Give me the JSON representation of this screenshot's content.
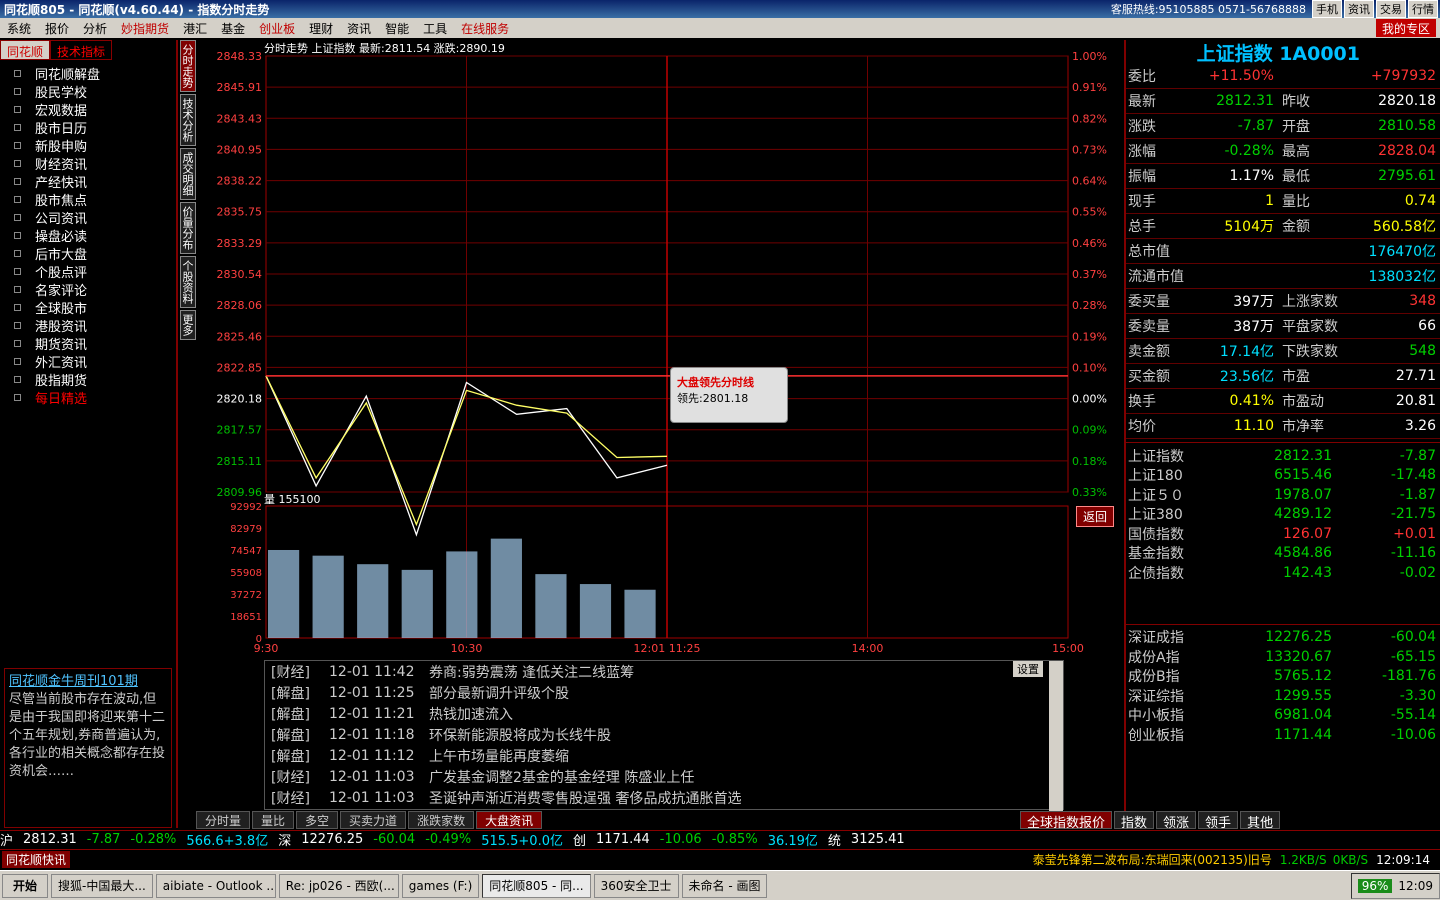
{
  "window": {
    "title": "同花顺805 - 同花顺(v4.60.44) - 指数分时走势",
    "hotline": "客服热线:95105885 0571-56768888",
    "buttons": [
      "手机",
      "资讯",
      "交易",
      "行情"
    ]
  },
  "menu": {
    "items": [
      "系统",
      "报价",
      "分析",
      "妙指期货",
      "港汇",
      "基金",
      "创业板",
      "理财",
      "资讯",
      "智能",
      "工具",
      "在线服务"
    ],
    "red_items": [
      3,
      6,
      11
    ],
    "zone": "我的专区"
  },
  "left_panel": {
    "tabs": [
      "同花顺",
      "技术指标"
    ],
    "items": [
      "同花顺解盘",
      "股民学校",
      "宏观数据",
      "股市日历",
      "新股申购",
      "财经资讯",
      "产经快讯",
      "股市焦点",
      "公司资讯",
      "操盘必读",
      "后市大盘",
      "个股点评",
      "名家评论",
      "全球股市",
      "港股资讯",
      "期货资讯",
      "外汇资讯",
      "股指期货",
      "每日精选"
    ],
    "news_box": {
      "headline": "同花顺金牛周刊101期",
      "body": "尽管当前股市存在波动,但是由于我国即将迎来第十二个五年规划,券商普遍认为,各行业的相关概念都存在投资机会……"
    }
  },
  "vertical_tabs": [
    "分时走势",
    "技术分析",
    "成交明细",
    "价量分布",
    "个股资料",
    "更多"
  ],
  "chart": {
    "header": "分时走势  上证指数  最新:2811.54  涨跌:2890.19",
    "vol_header": "量 155100",
    "tip_title": "大盘领先分时线",
    "tip_value": "领先:2801.18",
    "back_label": "返回",
    "price_ticks": [
      "2848.33",
      "2845.91",
      "2843.43",
      "2840.95",
      "2838.22",
      "2835.75",
      "2833.29",
      "2830.54",
      "2828.06",
      "2825.46",
      "2822.85",
      "2820.18",
      "2817.57",
      "2815.11",
      "2809.96"
    ],
    "pct_ticks": [
      "1.00%",
      "0.91%",
      "0.82%",
      "0.73%",
      "0.64%",
      "0.55%",
      "0.46%",
      "0.37%",
      "0.28%",
      "0.19%",
      "0.10%",
      "0.00%",
      "0.09%",
      "0.18%",
      "0.33%"
    ],
    "vol_ticks": [
      "92992",
      "82979",
      "74547",
      "55908",
      "37272",
      "18651",
      "0"
    ],
    "time_ticks": [
      "9:30",
      "10:30",
      "12:01 11:25",
      "14:00",
      "15:00"
    ]
  },
  "chart_data": {
    "type": "line",
    "title": "",
    "xlabel": "",
    "ylabel": "",
    "ylim": [
      2809.96,
      2848.33
    ],
    "x": [
      "9:30",
      "9:45",
      "10:00",
      "10:15",
      "10:30",
      "10:45",
      "11:00",
      "11:15",
      "11:25"
    ],
    "series": [
      {
        "name": "",
        "values": [
          2820.18,
          2810.5,
          2818.4,
          2806.2,
          2819.6,
          2816.8,
          2817.3,
          2811.2,
          2812.31
        ]
      },
      {
        "name": "",
        "values": [
          2820.18,
          2811.2,
          2817.8,
          2807.1,
          2818.9,
          2817.6,
          2816.9,
          2813.0,
          2813.1
        ]
      }
    ],
    "volume": [
      62000,
      58000,
      52000,
      48000,
      61000,
      70000,
      45000,
      38000,
      34000
    ]
  },
  "news_list": {
    "settings": "设置",
    "rows": [
      {
        "cat": "[财经]",
        "date": "12-01 11:42",
        "text": "券商:弱势震荡 逢低关注二线蓝筹"
      },
      {
        "cat": "[解盘]",
        "date": "12-01 11:25",
        "text": "部分最新调升评级个股"
      },
      {
        "cat": "[解盘]",
        "date": "12-01 11:21",
        "text": "热钱加速流入"
      },
      {
        "cat": "[解盘]",
        "date": "12-01 11:18",
        "text": "环保新能源股将成为长线牛股"
      },
      {
        "cat": "[解盘]",
        "date": "12-01 11:12",
        "text": "上午市场量能再度萎缩"
      },
      {
        "cat": "[财经]",
        "date": "12-01 11:03",
        "text": "广发基金调整2基金的基金经理 陈盛业上任"
      },
      {
        "cat": "[财经]",
        "date": "12-01 11:03",
        "text": "圣诞钟声渐近消费零售股逞强  奢侈品成抗通胀首选"
      }
    ]
  },
  "bottom_tabs": [
    "分时量",
    "量比",
    "多空",
    "买卖力道",
    "涨跌家数",
    "大盘资讯"
  ],
  "right_panel": {
    "title": "上证指数 1A0001",
    "rows": [
      {
        "l1": "委比",
        "v1": "+11.50%",
        "c1": "up",
        "l2": "",
        "v2": "+797932",
        "c2": "up"
      },
      {
        "l1": "最新",
        "v1": "2812.31",
        "c1": "dn",
        "l2": "昨收",
        "v2": "2820.18",
        "c2": "wh"
      },
      {
        "l1": "涨跌",
        "v1": "-7.87",
        "c1": "dn",
        "l2": "开盘",
        "v2": "2810.58",
        "c2": "dn"
      },
      {
        "l1": "涨幅",
        "v1": "-0.28%",
        "c1": "dn",
        "l2": "最高",
        "v2": "2828.04",
        "c2": "up"
      },
      {
        "l1": "振幅",
        "v1": "1.17%",
        "c1": "wh",
        "l2": "最低",
        "v2": "2795.61",
        "c2": "dn"
      },
      {
        "l1": "现手",
        "v1": "1",
        "c1": "yl",
        "l2": "量比",
        "v2": "0.74",
        "c2": "yl"
      },
      {
        "l1": "总手",
        "v1": "5104万",
        "c1": "yl",
        "l2": "金额",
        "v2": "560.58亿",
        "c2": "yl"
      },
      {
        "l1": "总市值",
        "v1": "",
        "c1": "wh",
        "l2": "",
        "v2": "176470亿",
        "c2": "cy"
      },
      {
        "l1": "流通市值",
        "v1": "",
        "c1": "wh",
        "l2": "",
        "v2": "138032亿",
        "c2": "cy"
      },
      {
        "l1": "委买量",
        "v1": "397万",
        "c1": "wh",
        "l2": "上涨家数",
        "v2": "348",
        "c2": "up"
      },
      {
        "l1": "委卖量",
        "v1": "387万",
        "c1": "wh",
        "l2": "平盘家数",
        "v2": "66",
        "c2": "wh"
      },
      {
        "l1": "卖金额",
        "v1": "17.14亿",
        "c1": "cy",
        "l2": "下跌家数",
        "v2": "548",
        "c2": "dn"
      },
      {
        "l1": "买金额",
        "v1": "23.56亿",
        "c1": "cy",
        "l2": "市盈",
        "v2": "27.71",
        "c2": "wh"
      },
      {
        "l1": "换手",
        "v1": "0.41%",
        "c1": "yl",
        "l2": "市盈动",
        "v2": "20.81",
        "c2": "wh"
      },
      {
        "l1": "均价",
        "v1": "11.10",
        "c1": "yl",
        "l2": "市净率",
        "v2": "3.26",
        "c2": "wh"
      }
    ],
    "indices_a": [
      {
        "n": "上证指数",
        "p": "2812.31",
        "c": "-7.87"
      },
      {
        "n": "上证180",
        "p": "6515.46",
        "c": "-17.48"
      },
      {
        "n": "上证５０",
        "p": "1978.07",
        "c": "-1.87"
      },
      {
        "n": "上证380",
        "p": "4289.12",
        "c": "-21.75"
      },
      {
        "n": "国债指数",
        "p": "126.07",
        "c": "+0.01"
      },
      {
        "n": "基金指数",
        "p": "4584.86",
        "c": "-11.16"
      },
      {
        "n": "企债指数",
        "p": "142.43",
        "c": "-0.02"
      }
    ],
    "indices_b": [
      {
        "n": "深证成指",
        "p": "12276.25",
        "c": "-60.04"
      },
      {
        "n": "成份A指",
        "p": "13320.67",
        "c": "-65.15"
      },
      {
        "n": "成份B指",
        "p": "5765.12",
        "c": "-181.76"
      },
      {
        "n": "深证综指",
        "p": "1299.55",
        "c": "-3.30"
      },
      {
        "n": "中小板指",
        "p": "6981.04",
        "c": "-55.14"
      },
      {
        "n": "创业板指",
        "p": "1171.44",
        "c": "-10.06"
      }
    ],
    "tabs": [
      "全球指数报价",
      "指数",
      "领涨",
      "领手",
      "其他"
    ]
  },
  "status_bar": {
    "items": [
      "沪",
      "2812.31",
      "-7.87",
      "-0.28%",
      "566.6+3.8亿",
      "深",
      "12276.25",
      "-60.04",
      "-0.49%",
      "515.5+0.0亿",
      "创",
      "1171.44",
      "-10.06",
      "-0.85%",
      "36.19亿",
      "统",
      "3125.41"
    ],
    "speed": "1.2KB/S",
    "speed2": "0KB/S",
    "badge": "同花顺快讯",
    "marquee": "泰莹先锋第二波布局:东瑞回来(002135)旧号",
    "clock": "12:09:14"
  },
  "taskbar": {
    "start": "开始",
    "tasks": [
      "搜狐-中国最大...",
      "aibiate - Outlook ...",
      "Re: jp026 - 西欧(...",
      "games (F:)",
      "同花顺805 - 同...",
      "360安全卫士",
      "未命名 - 画图"
    ],
    "active": 4,
    "battery": "96%",
    "time": "12:09"
  }
}
